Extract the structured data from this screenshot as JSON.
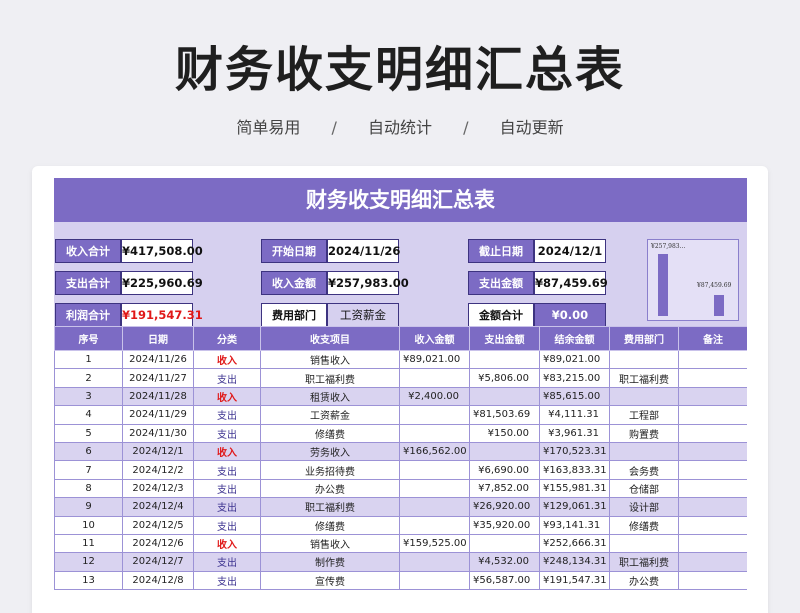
{
  "page": {
    "title": "财务收支明细汇总表",
    "tagline": [
      "简单易用",
      "/",
      "自动统计",
      "/",
      "自动更新"
    ]
  },
  "sheet": {
    "banner": "财务收支明细汇总表",
    "summary": {
      "income_total": {
        "label": "收入合计",
        "value": "¥417,508.00"
      },
      "expense_total": {
        "label": "支出合计",
        "value": "¥225,960.69"
      },
      "profit_total": {
        "label": "利润合计",
        "value": "¥191,547.31"
      },
      "start_date": {
        "label": "开始日期",
        "value": "2024/11/26"
      },
      "income_amount": {
        "label": "收入金额",
        "value": "¥257,983.00"
      },
      "department": {
        "label": "费用部门",
        "value": "工资薪金"
      },
      "end_date": {
        "label": "截止日期",
        "value": "2024/12/1"
      },
      "expense_amount": {
        "label": "支出金额",
        "value": "¥87,459.69"
      },
      "amount_total": {
        "label": "金额合计",
        "value": "¥0.00"
      }
    },
    "mini_chart": {
      "income_label": "¥257,983…",
      "expense_label": "¥87,459.69",
      "values": [
        257983.0,
        87459.69
      ],
      "max": 257983.0
    },
    "columns": [
      "序号",
      "日期",
      "分类",
      "收支项目",
      "收入金额",
      "支出金额",
      "结余金额",
      "费用部门",
      "备注"
    ],
    "rows": [
      [
        "1",
        "2024/11/26",
        "收入",
        "销售收入",
        "¥89,021.00",
        "",
        "¥89,021.00",
        "",
        ""
      ],
      [
        "2",
        "2024/11/27",
        "支出",
        "职工福利费",
        "",
        "¥5,806.00",
        "¥83,215.00",
        "职工福利费",
        ""
      ],
      [
        "3",
        "2024/11/28",
        "收入",
        "租赁收入",
        "¥2,400.00",
        "",
        "¥85,615.00",
        "",
        ""
      ],
      [
        "4",
        "2024/11/29",
        "支出",
        "工资薪金",
        "",
        "¥81,503.69",
        "¥4,111.31",
        "工程部",
        ""
      ],
      [
        "5",
        "2024/11/30",
        "支出",
        "修缮费",
        "",
        "¥150.00",
        "¥3,961.31",
        "购置费",
        ""
      ],
      [
        "6",
        "2024/12/1",
        "收入",
        "劳务收入",
        "¥166,562.00",
        "",
        "¥170,523.31",
        "",
        ""
      ],
      [
        "7",
        "2024/12/2",
        "支出",
        "业务招待费",
        "",
        "¥6,690.00",
        "¥163,833.31",
        "会务费",
        ""
      ],
      [
        "8",
        "2024/12/3",
        "支出",
        "办公费",
        "",
        "¥7,852.00",
        "¥155,981.31",
        "仓储部",
        ""
      ],
      [
        "9",
        "2024/12/4",
        "支出",
        "职工福利费",
        "",
        "¥26,920.00",
        "¥129,061.31",
        "设计部",
        ""
      ],
      [
        "10",
        "2024/12/5",
        "支出",
        "修缮费",
        "",
        "¥35,920.00",
        "¥93,141.31",
        "修缮费",
        ""
      ],
      [
        "11",
        "2024/12/6",
        "收入",
        "销售收入",
        "¥159,525.00",
        "",
        "¥252,666.31",
        "",
        ""
      ],
      [
        "12",
        "2024/12/7",
        "支出",
        "制作费",
        "",
        "¥4,532.00",
        "¥248,134.31",
        "职工福利费",
        ""
      ],
      [
        "13",
        "2024/12/8",
        "支出",
        "宣传费",
        "",
        "¥56,587.00",
        "¥191,547.31",
        "办公费",
        ""
      ]
    ]
  }
}
